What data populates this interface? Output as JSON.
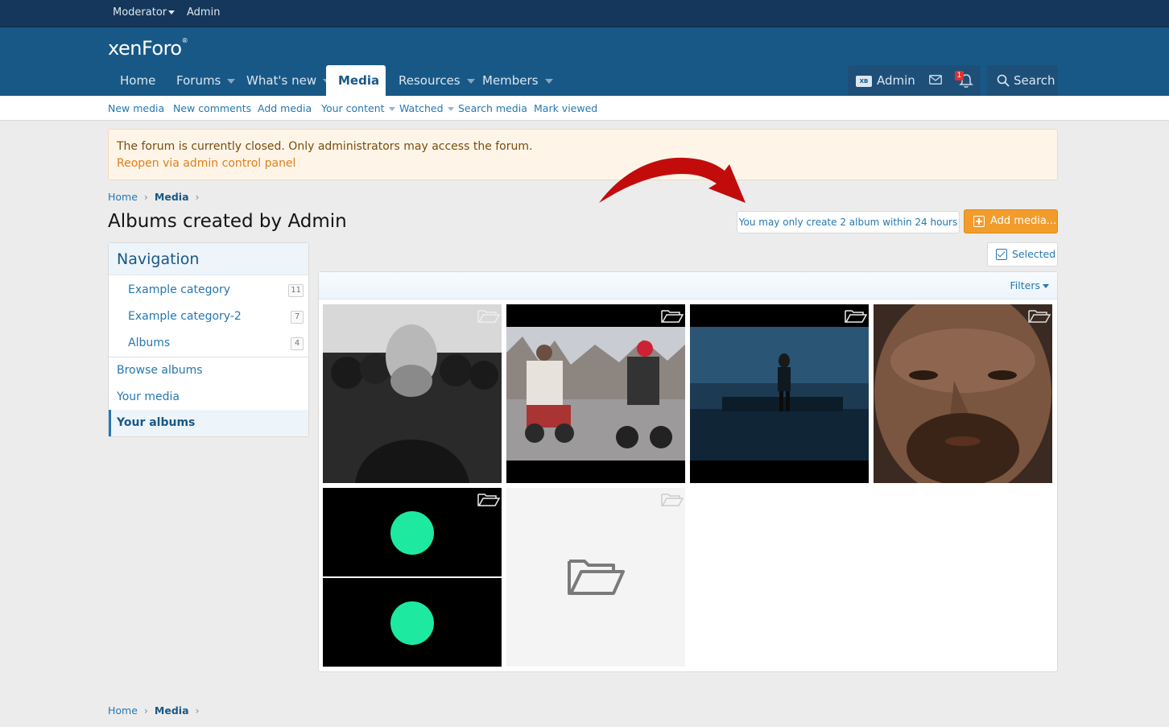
{
  "staff_bar": {
    "moderator": "Moderator",
    "admin": "Admin"
  },
  "logo": {
    "text": "xenForo",
    "mark": "®"
  },
  "nav": {
    "tabs": [
      {
        "label": "Home"
      },
      {
        "label": "Forums"
      },
      {
        "label": "What's new"
      },
      {
        "label": "Media"
      },
      {
        "label": "Resources"
      },
      {
        "label": "Members"
      }
    ],
    "active": "Media",
    "account_label": "Admin",
    "avatar_text": "XB",
    "alert_count": "1",
    "search_label": "Search"
  },
  "subnav": {
    "items": [
      {
        "label": "New media"
      },
      {
        "label": "New comments"
      },
      {
        "label": "Add media"
      },
      {
        "label": "Your content"
      },
      {
        "label": "Watched"
      },
      {
        "label": "Search media"
      },
      {
        "label": "Mark viewed"
      }
    ]
  },
  "notice": {
    "message": "The forum is currently closed. Only administrators may access the forum.",
    "link": "Reopen via admin control panel"
  },
  "breadcrumb": {
    "home": "Home",
    "current": "Media"
  },
  "page_title": "Albums created by Admin",
  "limit_message": "You may only create 2 album within 24 hours",
  "add_media_label": "Add media...",
  "selected_label": "Selected",
  "filters_label": "Filters",
  "sidebar": {
    "title": "Navigation",
    "categories": [
      {
        "label": "Example category",
        "count": "11"
      },
      {
        "label": "Example category-2",
        "count": "7"
      },
      {
        "label": "Albums",
        "count": "4"
      }
    ],
    "links": [
      {
        "label": "Browse albums"
      },
      {
        "label": "Your media"
      },
      {
        "label": "Your albums"
      }
    ]
  },
  "album_thumbs": [
    {
      "name": "album-thumb-1"
    },
    {
      "name": "album-thumb-2"
    },
    {
      "name": "album-thumb-3"
    },
    {
      "name": "album-thumb-4"
    },
    {
      "name": "album-thumb-5"
    },
    {
      "name": "album-thumb-6"
    }
  ],
  "colors": {
    "header": "#185886",
    "staff_bar": "#14375b",
    "accent": "#2577b1",
    "button_orange": "#f29c2b",
    "notice_bg": "#fef5e8",
    "annotation_arrow": "#c20c0c"
  }
}
